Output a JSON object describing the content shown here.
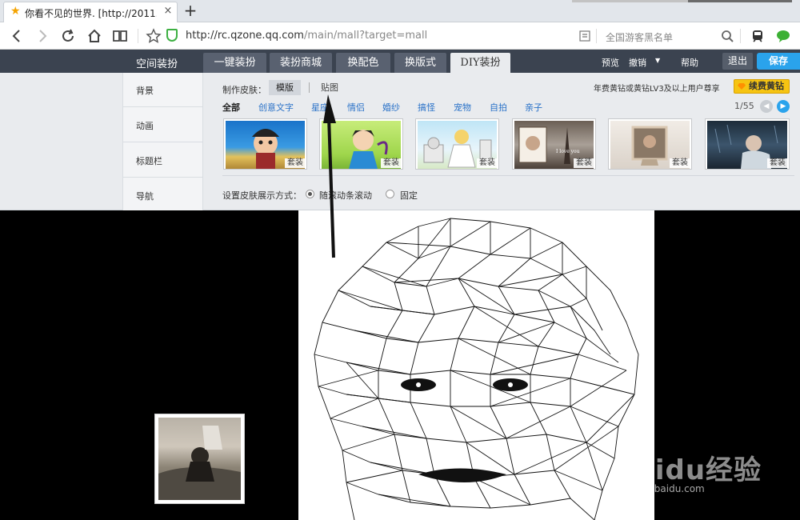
{
  "browser": {
    "tab_title": "你看不见的世界. [http://2011...",
    "tab_close": "×",
    "new_tab": "+",
    "url_host": "http://rc.qzone.qq.com",
    "url_path": "/main/mall?target=mall",
    "search_placeholder": "全国游客黑名单"
  },
  "qzone": {
    "title": "空间装扮",
    "tabs": [
      "一键装扮",
      "装扮商城",
      "换配色",
      "换版式",
      "DIY装扮"
    ],
    "active_tab": "DIY装扮",
    "actions": {
      "preview": "预览",
      "undo": "撤销",
      "help": "帮助",
      "exit": "退出",
      "save": "保存"
    }
  },
  "sidebar": {
    "items": [
      "背景",
      "动画",
      "标题栏",
      "导航"
    ]
  },
  "diy": {
    "make_label": "制作皮肤：",
    "template": "模版",
    "sticker": "贴图",
    "vip_note": "年费黄钻或黄钻LV3及以上用户尊享",
    "vip_button": "续费黄钻",
    "categories": [
      "全部",
      "创意文字",
      "星座",
      "情侣",
      "婚纱",
      "搞怪",
      "宠物",
      "自拍",
      "亲子"
    ],
    "pager": "1/55",
    "thumb_tag": "套装",
    "mode_label": "设置皮肤展示方式：",
    "mode_options": [
      "随滚动条滚动",
      "固定"
    ]
  },
  "watermark": {
    "brand": "Baidu经验",
    "sub": "jingyan.baidu.com"
  },
  "colors": {
    "qzone_header": "#3b4350",
    "accent_blue": "#2a72c8",
    "vip_yellow": "#f6c412",
    "save_blue": "#2aa3ec"
  }
}
